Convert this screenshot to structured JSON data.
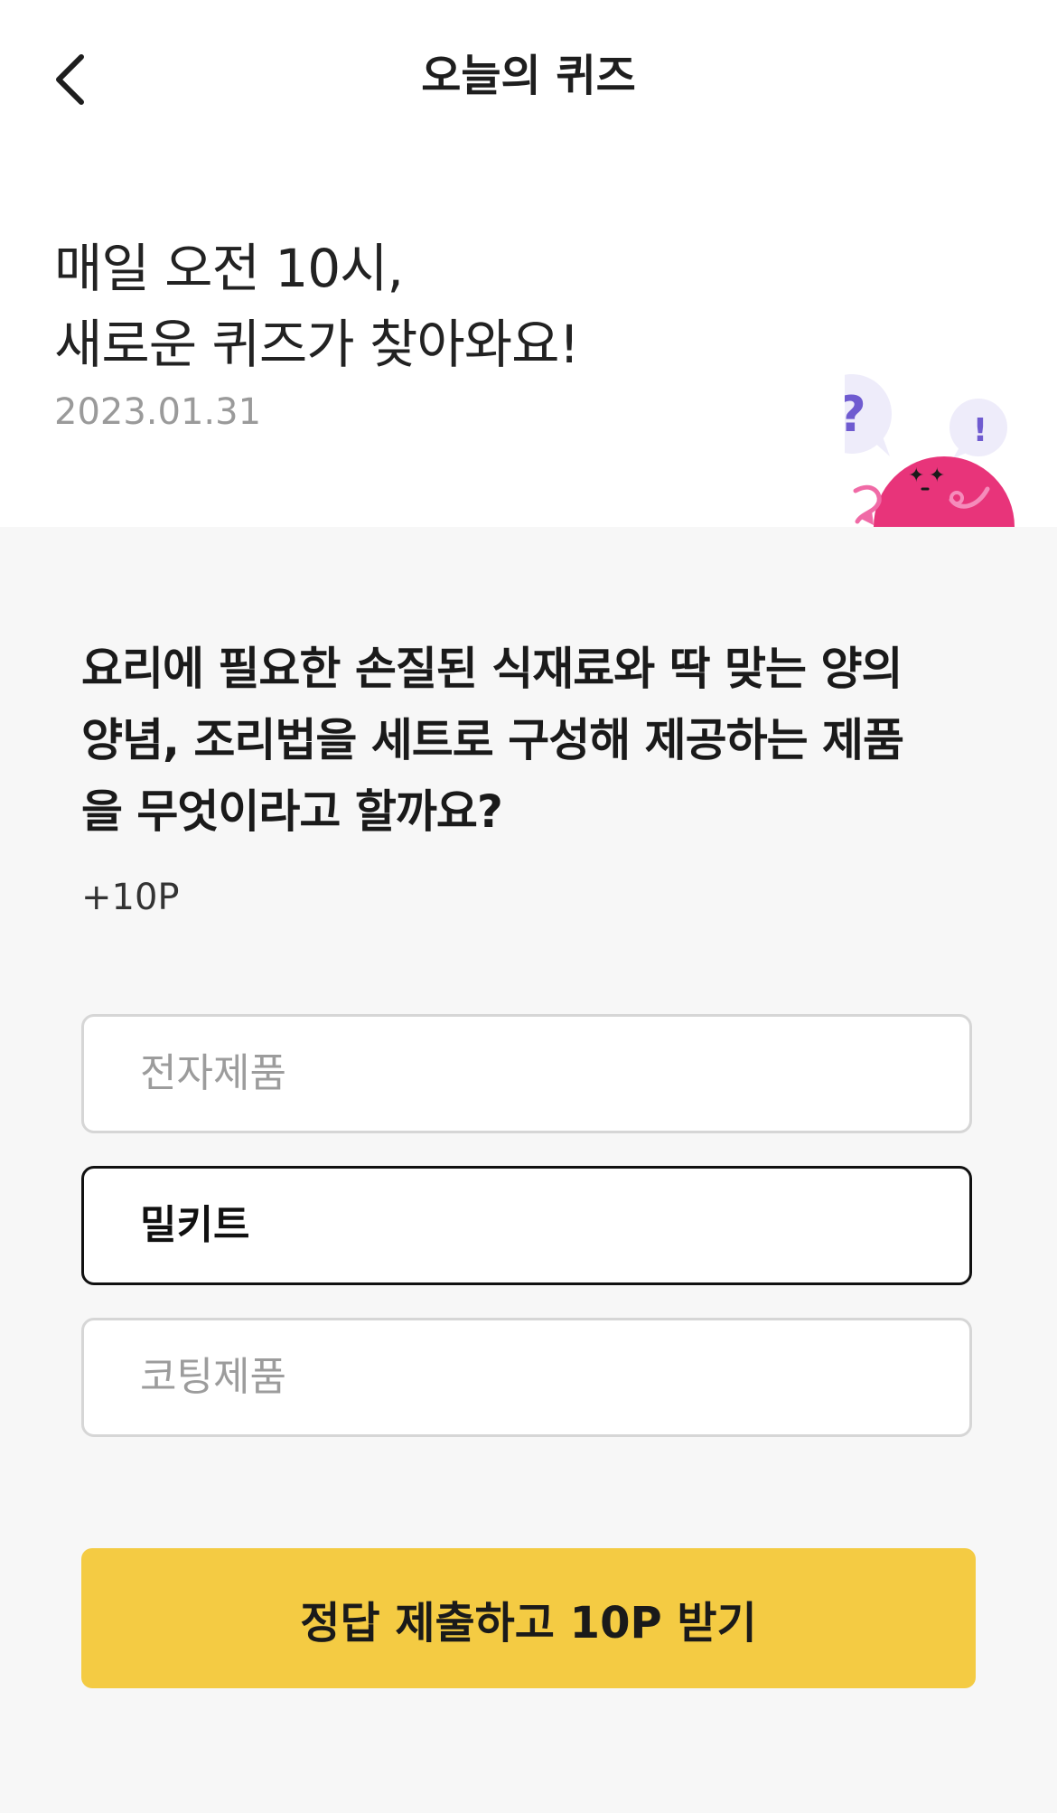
{
  "header": {
    "title": "오늘의 퀴즈",
    "back_icon": "chevron-left-icon"
  },
  "intro": {
    "line1": "매일 오전 10시,",
    "line2": "새로운 퀴즈가 찾아와요!",
    "date": "2023.01.31"
  },
  "mascot": {
    "question_mark": "?",
    "exclamation_mark": "!",
    "body_color": "#e8347a",
    "bubble_color": "#eeecfa",
    "mark_color": "#6f5bd0"
  },
  "quiz": {
    "question_lines": [
      "요리에 필요한 손질된 식재료와 딱 맞는 양의",
      "양념, 조리법을 세트로 구성해 제공하는 제품",
      "을 무엇이라고 할까요?"
    ],
    "points": "+10P",
    "options": [
      {
        "label": "전자제품",
        "selected": false
      },
      {
        "label": "밀키트",
        "selected": true
      },
      {
        "label": "코팅제품",
        "selected": false
      }
    ],
    "submit_label": "정답 제출하고 10P 받기"
  },
  "colors": {
    "accent": "#f4cb43",
    "background_quiz": "#f7f7f7",
    "selected_border": "#111111",
    "option_border": "#d6d6d6",
    "muted_text": "#9a9a9a"
  }
}
